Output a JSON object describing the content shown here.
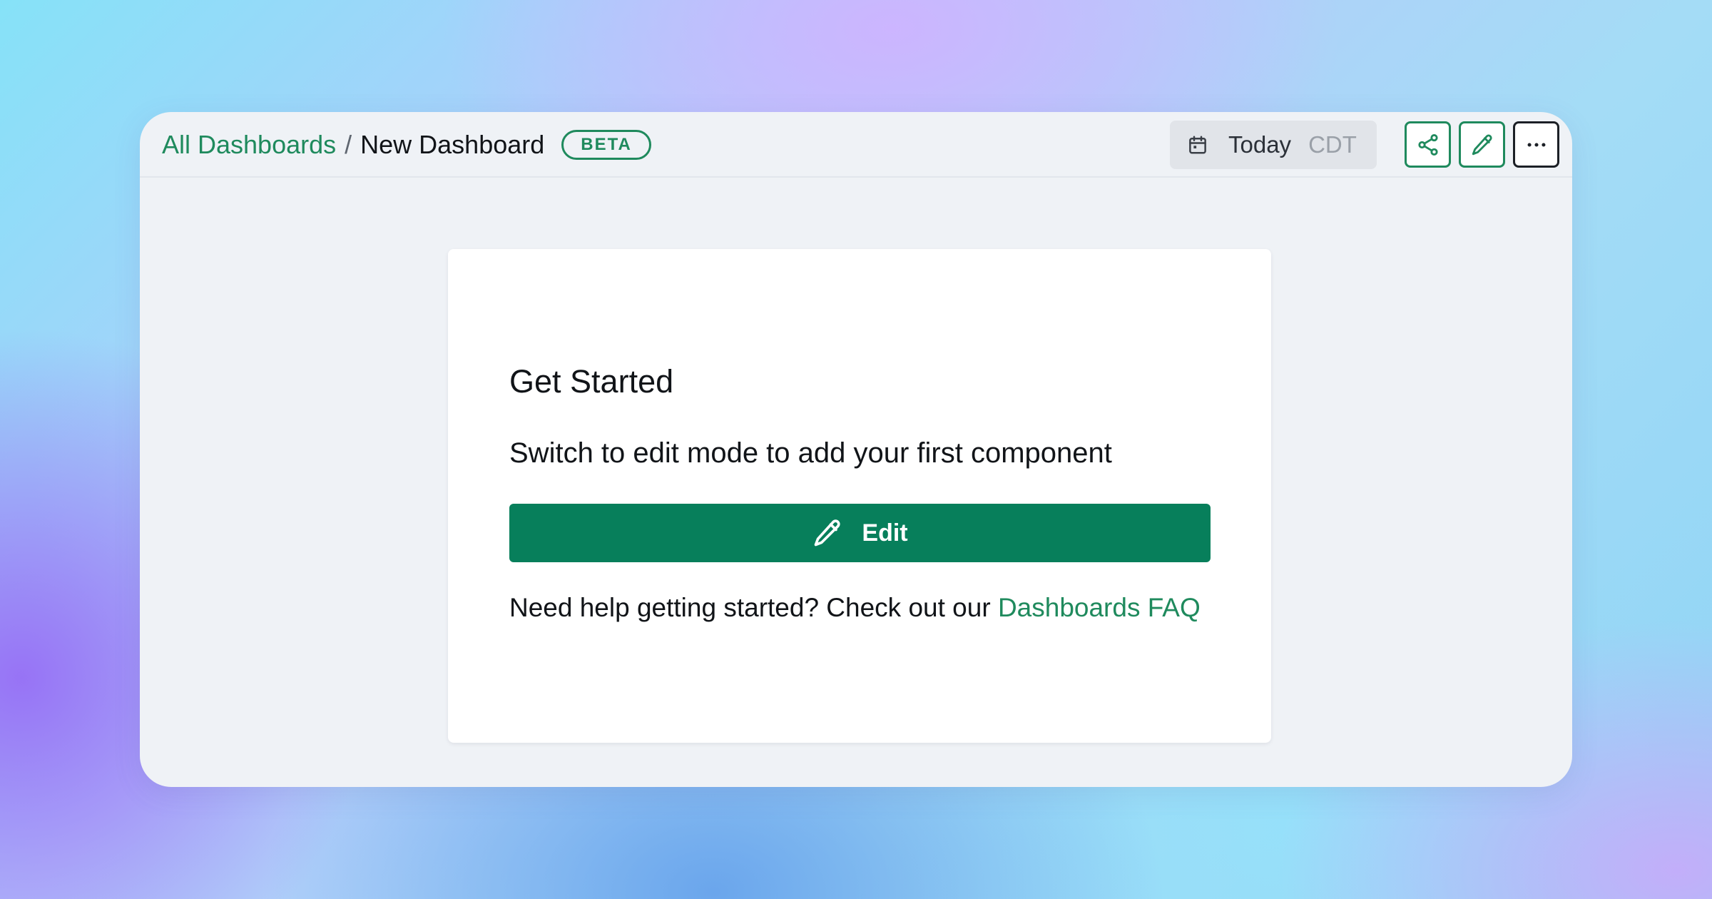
{
  "header": {
    "breadcrumb_root": "All Dashboards",
    "breadcrumb_separator": "/",
    "breadcrumb_current": "New Dashboard",
    "badge": "BETA",
    "date_label": "Today",
    "timezone": "CDT"
  },
  "toolbar_icons": [
    "calendar-icon",
    "share-icon",
    "pencil-icon",
    "more-icon"
  ],
  "card": {
    "title": "Get Started",
    "subtitle": "Switch to edit mode to add your first component",
    "edit_button_label": "Edit",
    "help_prefix": "Need help getting started? Check out our ",
    "help_link": "Dashboards FAQ"
  },
  "colors": {
    "accent": "#1f8a5d",
    "primary_button": "#077f5b",
    "window_background": "#eff2f6"
  }
}
